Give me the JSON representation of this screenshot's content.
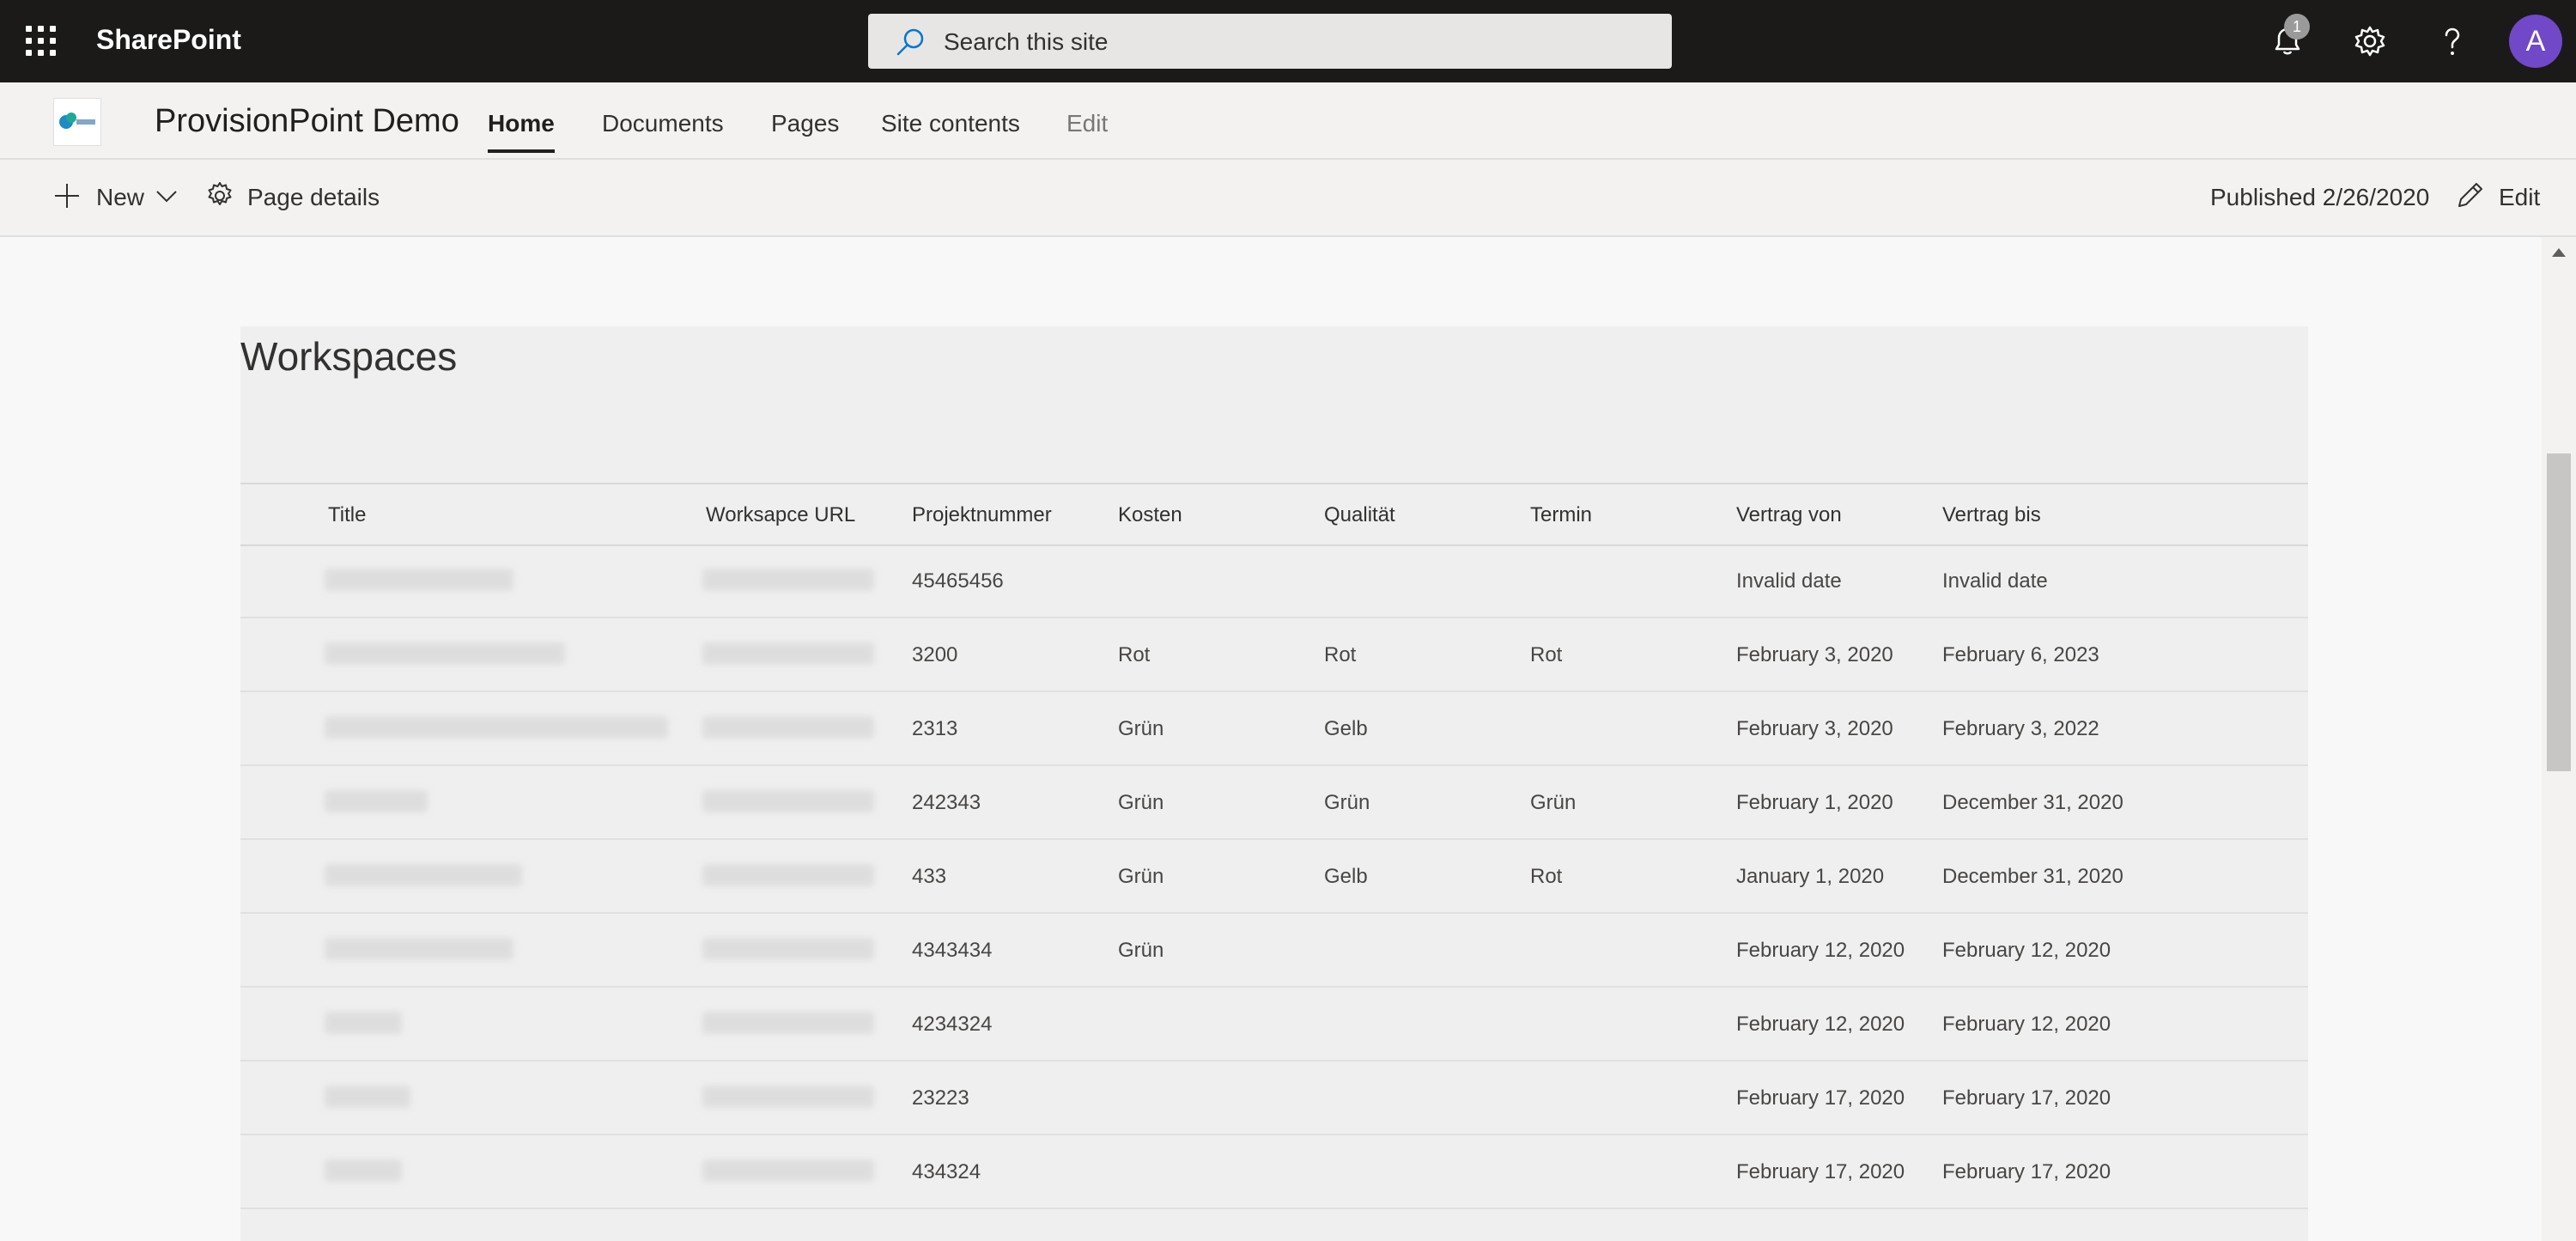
{
  "suite": {
    "brand": "SharePoint",
    "search_placeholder": "Search this site",
    "notification_count": "1",
    "avatar_initial": "A"
  },
  "site": {
    "title": "ProvisionPoint Demo",
    "nav": [
      "Home",
      "Documents",
      "Pages",
      "Site contents",
      "Edit"
    ]
  },
  "commandbar": {
    "new_label": "New",
    "page_details_label": "Page details",
    "published_label": "Published 2/26/2020",
    "edit_label": "Edit"
  },
  "webpart": {
    "title": "Workspaces",
    "columns": [
      "Title",
      "Worksapce URL",
      "Projektnummer",
      "Kosten",
      "Qualität",
      "Termin",
      "Vertrag von",
      "Vertrag bis"
    ],
    "rows": [
      {
        "projektnummer": "45465456",
        "kosten": "",
        "qualitaet": "",
        "termin": "",
        "von": "Invalid date",
        "bis": "Invalid date"
      },
      {
        "projektnummer": "3200",
        "kosten": "Rot",
        "qualitaet": "Rot",
        "termin": "Rot",
        "von": "February 3, 2020",
        "bis": "February 6, 2023"
      },
      {
        "projektnummer": "2313",
        "kosten": "Grün",
        "qualitaet": "Gelb",
        "termin": "",
        "von": "February 3, 2020",
        "bis": "February 3, 2022"
      },
      {
        "projektnummer": "242343",
        "kosten": "Grün",
        "qualitaet": "Grün",
        "termin": "Grün",
        "von": "February 1, 2020",
        "bis": "December 31, 2020"
      },
      {
        "projektnummer": "433",
        "kosten": "Grün",
        "qualitaet": "Gelb",
        "termin": "Rot",
        "von": "January 1, 2020",
        "bis": "December 31, 2020"
      },
      {
        "projektnummer": "4343434",
        "kosten": "Grün",
        "qualitaet": "",
        "termin": "",
        "von": "February 12, 2020",
        "bis": "February 12, 2020"
      },
      {
        "projektnummer": "4234324",
        "kosten": "",
        "qualitaet": "",
        "termin": "",
        "von": "February 12, 2020",
        "bis": "February 12, 2020"
      },
      {
        "projektnummer": "23223",
        "kosten": "",
        "qualitaet": "",
        "termin": "",
        "von": "February 17, 2020",
        "bis": "February 17, 2020"
      },
      {
        "projektnummer": "434324",
        "kosten": "",
        "qualitaet": "",
        "termin": "",
        "von": "February 17, 2020",
        "bis": "February 17, 2020"
      }
    ]
  },
  "icons": {
    "app_launcher": "waffle-icon",
    "search": "search-icon",
    "notifications": "bell-icon",
    "settings": "gear-icon",
    "help": "help-icon",
    "new": "plus-icon",
    "dropdown": "chevron-down-icon",
    "page_details": "gear-icon",
    "edit": "pencil-icon"
  },
  "colors": {
    "suitebar": "#1b1a19",
    "avatar": "#7048c8",
    "search_icon": "#0078d4"
  }
}
